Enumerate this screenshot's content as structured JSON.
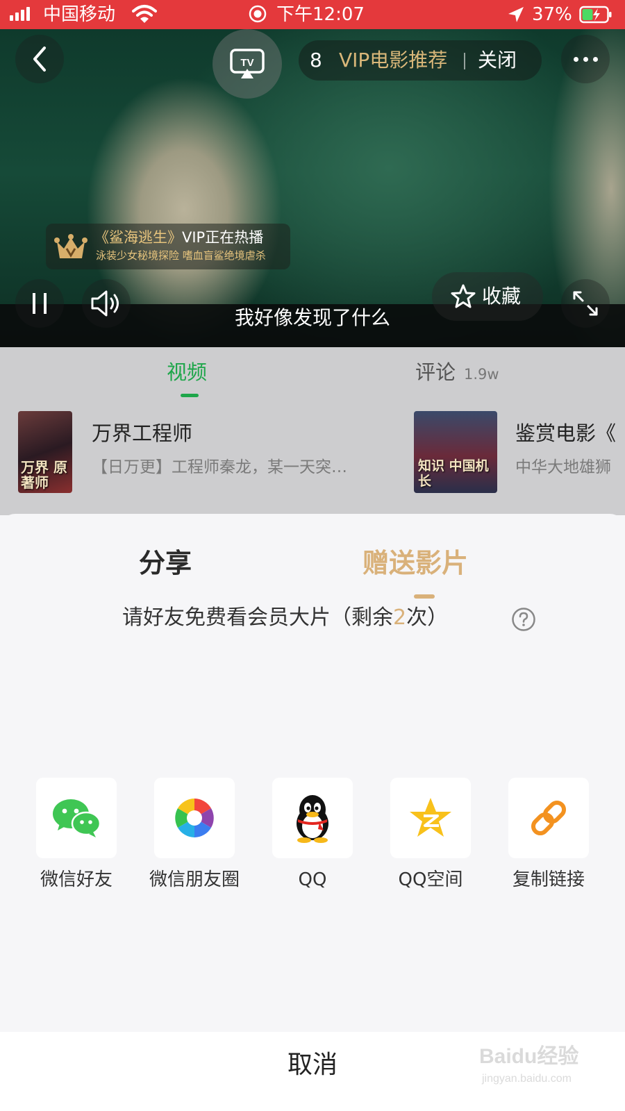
{
  "status_bar": {
    "carrier": "中国移动",
    "time": "下午12:07",
    "battery": "37%"
  },
  "player": {
    "queue_count": "8",
    "vip_title": "VIP电影推荐",
    "close_label": "关闭",
    "promo": {
      "title_highlight": "《鲨海逃生》",
      "title_rest": "VIP正在热播",
      "subtitle": "泳装少女秘境探险 嗜血盲鲨绝境虐杀"
    },
    "favorite_label": "收藏",
    "caption": "我好像发现了什么",
    "tv_icon_text": "TV"
  },
  "tabs": {
    "video": "视频",
    "comment": "评论",
    "comment_count": "1.9w"
  },
  "recommend": [
    {
      "title": "万界工程师",
      "desc": "【日万更】工程师秦龙，某一天突…",
      "poster_text": "万界 原著师"
    },
    {
      "title": "鉴赏电影《",
      "desc": "中华大地雄狮",
      "poster_text": "知识 中国机长"
    }
  ],
  "sheet": {
    "tab_share": "分享",
    "tab_gift": "赠送影片",
    "invite_prefix": "请好友免费看会员大片（剩余",
    "invite_count": "2",
    "invite_suffix": "次）",
    "channels": [
      {
        "label": "微信好友",
        "icon": "wechat-icon"
      },
      {
        "label": "微信朋友圈",
        "icon": "moments-icon"
      },
      {
        "label": "QQ",
        "icon": "qq-icon"
      },
      {
        "label": "QQ空间",
        "icon": "qzone-icon"
      },
      {
        "label": "复制链接",
        "icon": "link-icon"
      }
    ],
    "cancel": "取消"
  },
  "colors": {
    "status_red": "#e4393c",
    "tab_green": "#1ea64a",
    "gold": "#d9b17a"
  },
  "watermark": {
    "brand": "Baidu经验",
    "url": "jingyan.baidu.com"
  }
}
